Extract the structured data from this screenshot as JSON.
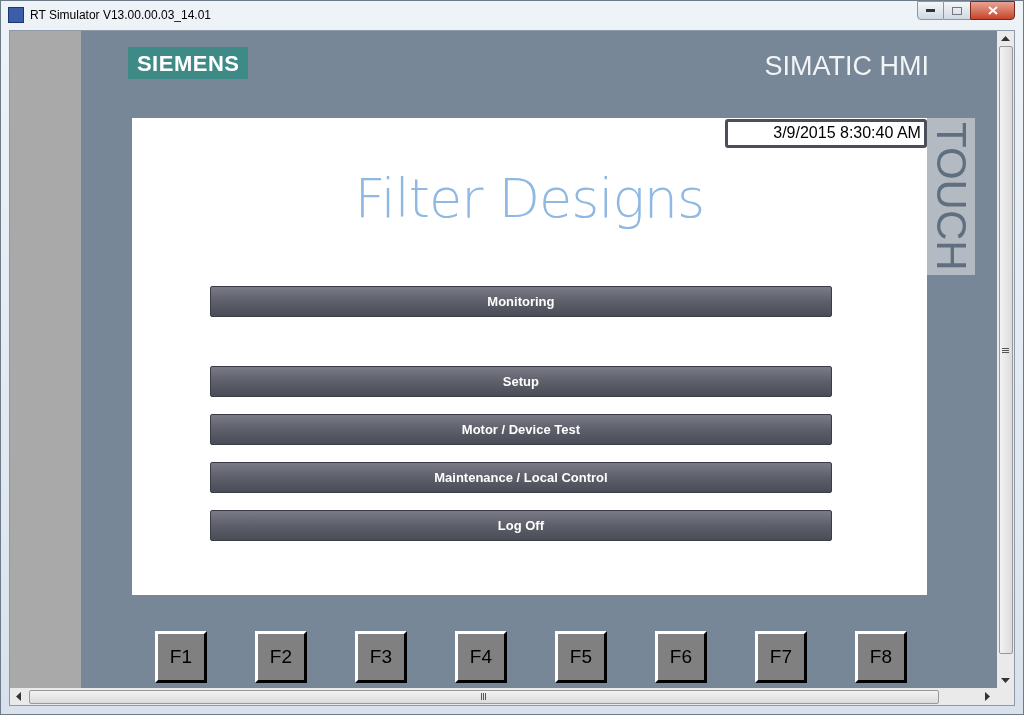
{
  "window": {
    "title": "RT Simulator V13.00.00.03_14.01"
  },
  "panel": {
    "brand": "SIEMENS",
    "product": "SIMATIC HMI",
    "side_label": "TOUCH"
  },
  "screen": {
    "datetime": "3/9/2015 8:30:40 AM",
    "title": "Filter Designs",
    "buttons": [
      {
        "label": "Monitoring"
      },
      {
        "label": "Setup"
      },
      {
        "label": "Motor / Device Test"
      },
      {
        "label": "Maintenance / Local Control"
      },
      {
        "label": "Log Off"
      }
    ]
  },
  "function_keys": [
    "F1",
    "F2",
    "F3",
    "F4",
    "F5",
    "F6",
    "F7",
    "F8"
  ]
}
